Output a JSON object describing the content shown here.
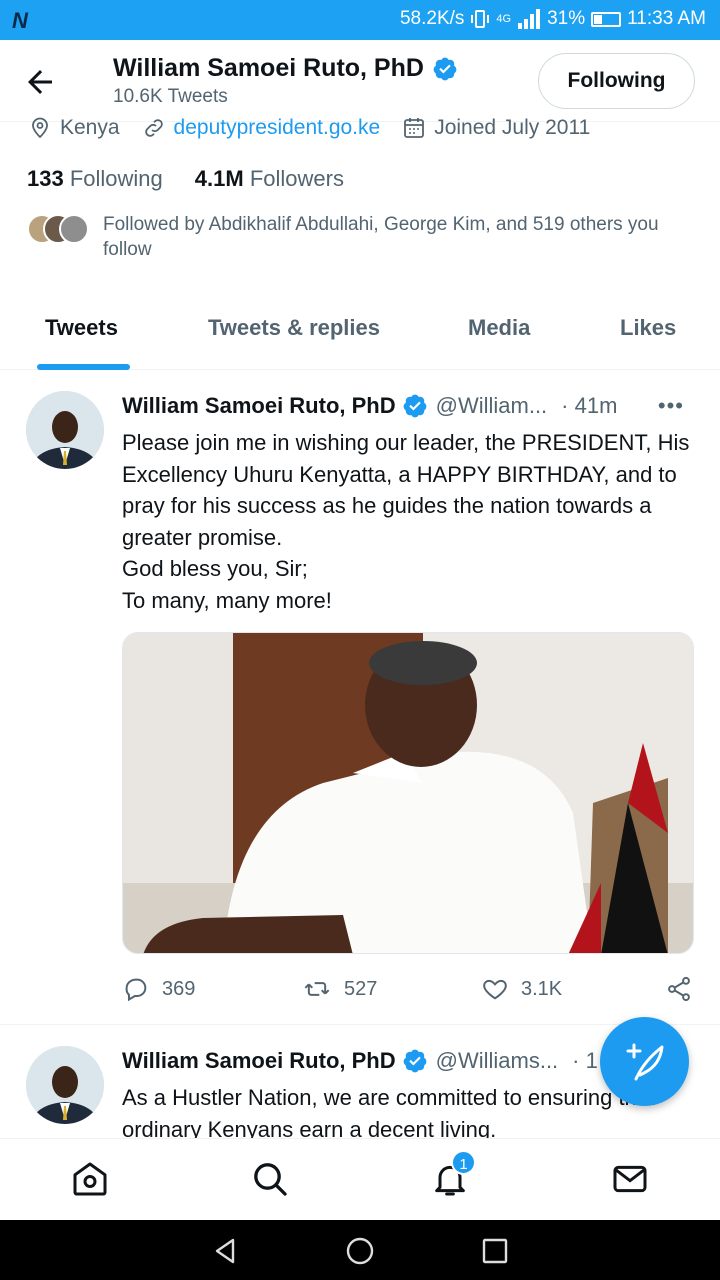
{
  "status_bar": {
    "speed": "58.2K/s",
    "network": "4G",
    "battery": "31%",
    "battery_level": 0.31,
    "time": "11:33 AM"
  },
  "header": {
    "name": "William Samoei Ruto, PhD",
    "tweets_count": "10.6K Tweets",
    "follow_label": "Following"
  },
  "profile": {
    "location": "Kenya",
    "website": "deputypresident.go.ke",
    "joined": "Joined July 2011",
    "following_count": "133",
    "following_label": "Following",
    "followers_count": "4.1M",
    "followers_label": "Followers",
    "followed_by": "Followed by Abdikhalif Abdullahi, George Kim, and 519 others you follow"
  },
  "tabs": [
    "Tweets",
    "Tweets & replies",
    "Media",
    "Likes"
  ],
  "tweets": [
    {
      "name": "William Samoei Ruto, PhD",
      "handle": "@William...",
      "time": "· 41m",
      "lines": [
        "Please join me in wishing our leader, the PRESIDENT, His Excellency Uhuru Kenyatta, a HAPPY BIRTHDAY, and to pray for his success as he guides the nation towards a greater promise.",
        "God bless you, Sir;",
        "To many, many more!"
      ],
      "replies": "369",
      "retweets": "527",
      "likes": "3.1K"
    },
    {
      "name": "William Samoei Ruto, PhD",
      "handle": "@Williams...",
      "time": "· 1",
      "text": "As a Hustler Nation, we are committed to ensuring that ordinary Kenyans earn a decent living."
    }
  ],
  "bottom_nav": {
    "notification_badge": "1",
    "icons": [
      "home-icon",
      "search-icon",
      "notifications-icon",
      "messages-icon"
    ]
  },
  "colors": {
    "accent": "#1d9bf0",
    "status_bar": "#1da1f2",
    "text": "#0f1419",
    "secondary_text": "#536471"
  }
}
